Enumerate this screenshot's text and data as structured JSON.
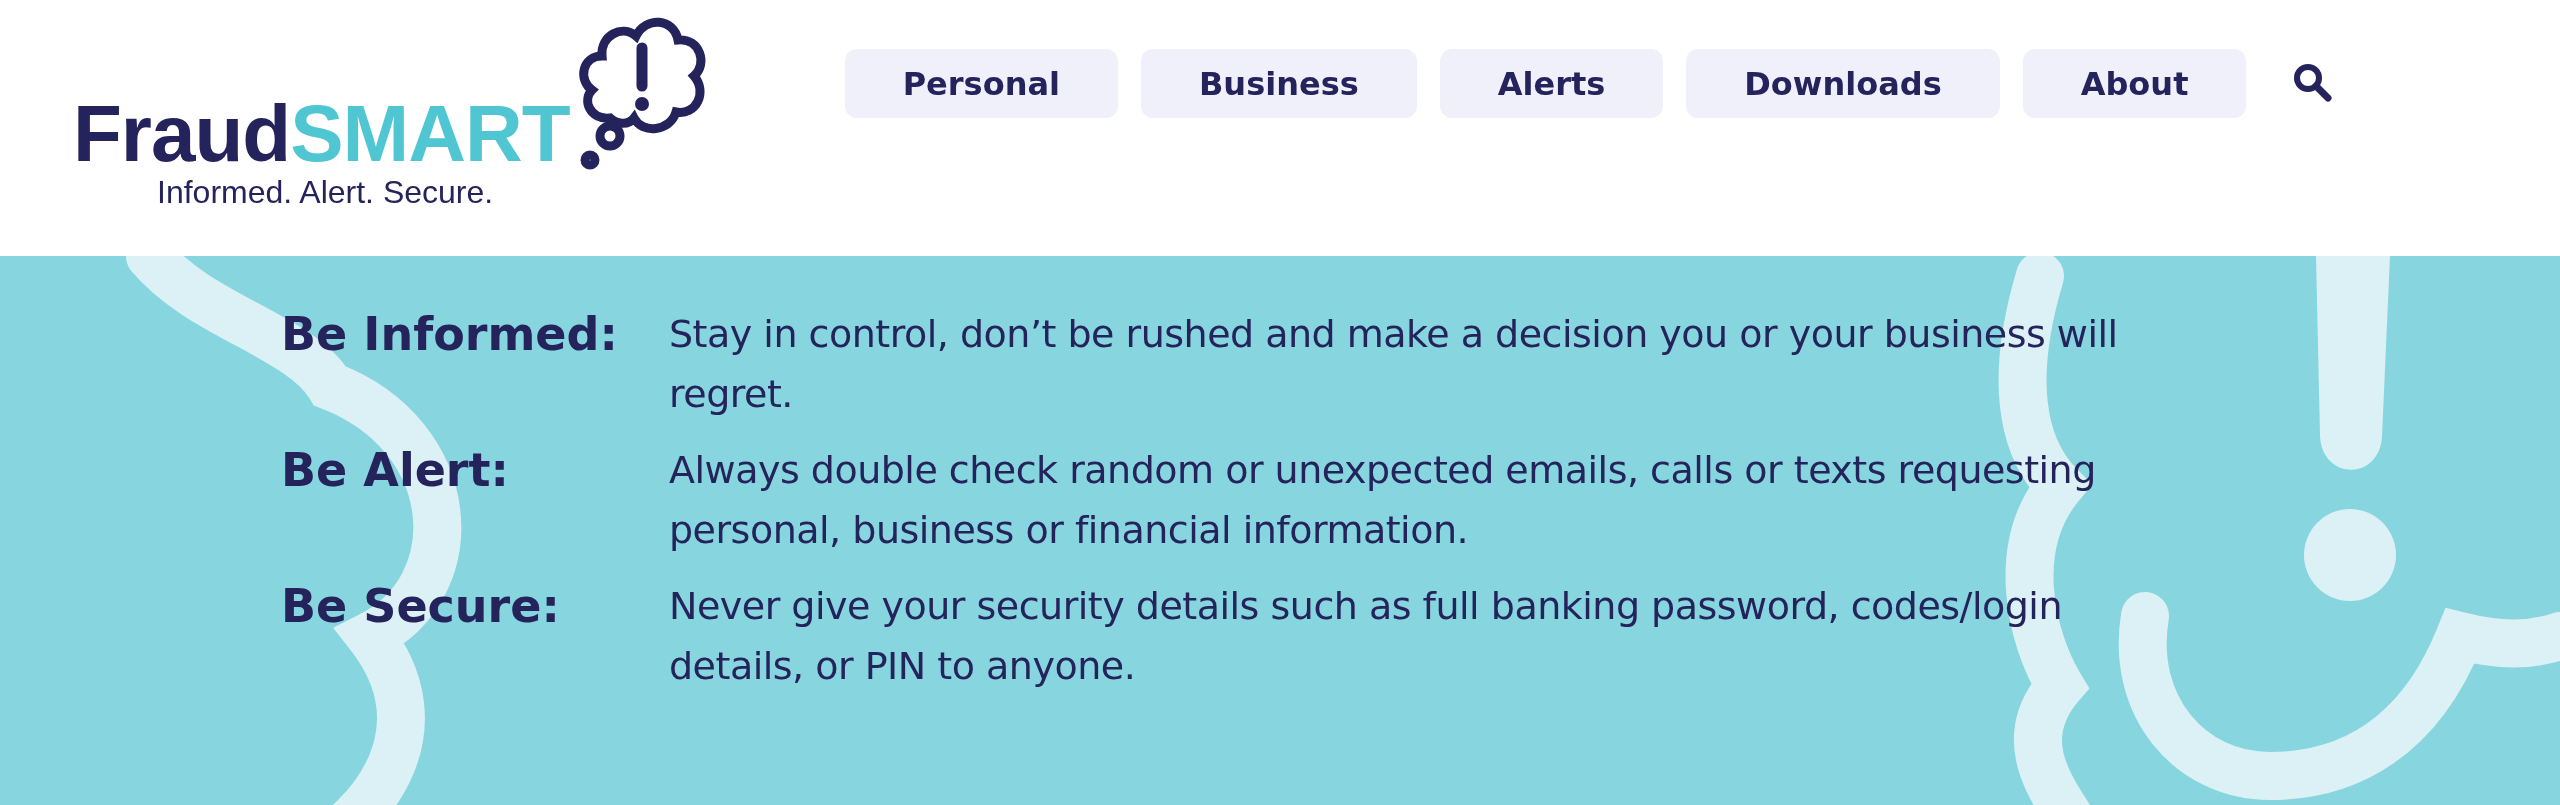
{
  "logo": {
    "word_1": "Fraud",
    "word_2": "SMART",
    "tagline": "Informed. Alert. Secure."
  },
  "nav": [
    {
      "label": "Personal"
    },
    {
      "label": "Business"
    },
    {
      "label": "Alerts"
    },
    {
      "label": "Downloads"
    },
    {
      "label": "About"
    }
  ],
  "tips": [
    {
      "label": "Be Informed:",
      "text": "Stay in control, don’t be rushed and make a decision you or your business will regret."
    },
    {
      "label": "Be Alert:",
      "text": "Always double check random or unexpected emails, calls or texts requesting personal, business or financial information."
    },
    {
      "label": "Be Secure:",
      "text": "Never give your security details such as full banking password, codes/login details, or PIN to anyone."
    }
  ]
}
